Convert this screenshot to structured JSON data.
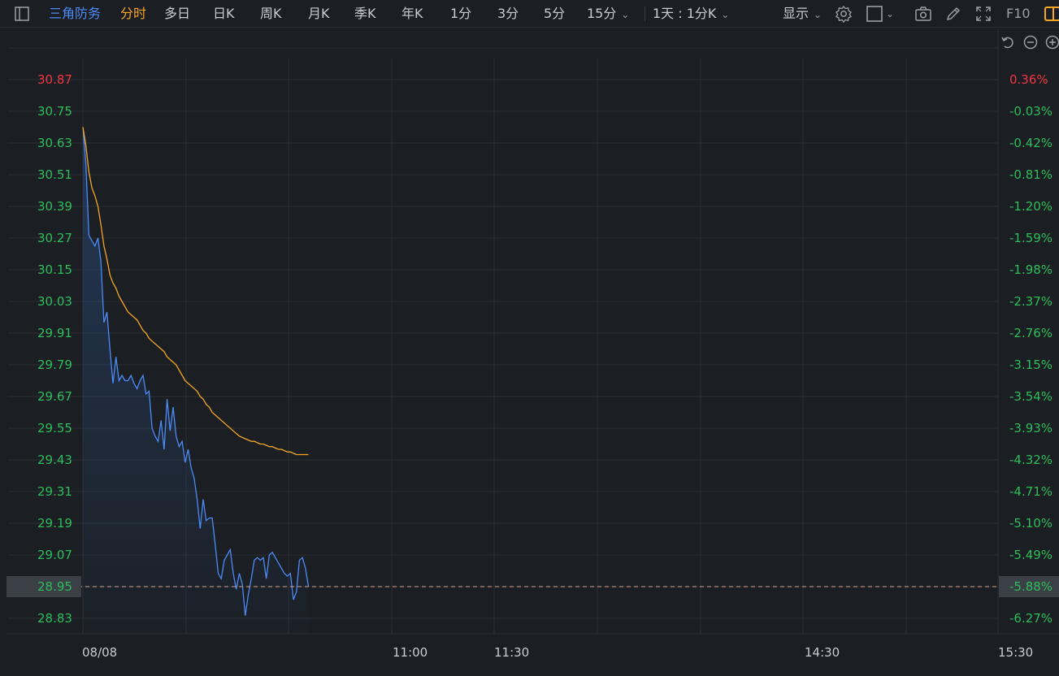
{
  "toolbar": {
    "stock_name": "三角防务",
    "tabs": [
      "分时",
      "多日",
      "日K",
      "周K",
      "月K",
      "季K",
      "年K",
      "1分",
      "3分",
      "5分",
      "15分"
    ],
    "active_tab": "分时",
    "period_select": "1天 : 1分K",
    "display_label": "显示",
    "f10_label": "F10"
  },
  "colors": {
    "background": "#1b1e22",
    "grid": "#2b3036",
    "price_line": "#4c8bf5",
    "avg_line": "#f6a623",
    "up": "#f23645",
    "down": "#2dbe5b",
    "current_marker": "#d9a48b"
  },
  "chart_data": {
    "type": "line",
    "x_ticks": [
      "08/08",
      "11:00",
      "11:30",
      "14:30",
      "15:30"
    ],
    "y_ticks_left": [
      "30.87",
      "30.75",
      "30.63",
      "30.51",
      "30.39",
      "30.27",
      "30.15",
      "30.03",
      "29.91",
      "29.79",
      "29.67",
      "29.55",
      "29.43",
      "29.31",
      "29.19",
      "29.07",
      "28.95",
      "28.83"
    ],
    "y_ticks_right": [
      "0.36%",
      "-0.03%",
      "-0.42%",
      "-0.81%",
      "-1.20%",
      "-1.59%",
      "-1.98%",
      "-2.37%",
      "-2.76%",
      "-3.15%",
      "-3.54%",
      "-3.93%",
      "-4.32%",
      "-4.71%",
      "-5.10%",
      "-5.49%",
      "-5.88%",
      "-6.27%"
    ],
    "ylim": [
      28.83,
      30.87
    ],
    "current_price": "28.95",
    "current_pct": "-5.88%",
    "series": [
      {
        "values": [
          30.69,
          30.55,
          30.28,
          30.26,
          30.24,
          30.27,
          30.18,
          29.95,
          29.99,
          29.85,
          29.72,
          29.82,
          29.73,
          29.75,
          29.73,
          29.73,
          29.75,
          29.72,
          29.7,
          29.73,
          29.75,
          29.68,
          29.69,
          29.55,
          29.52,
          29.5,
          29.58,
          29.47,
          29.66,
          29.54,
          29.63,
          29.52,
          29.48,
          29.5,
          29.42,
          29.47,
          29.4,
          29.36,
          29.28,
          29.17,
          29.28,
          29.2,
          29.21,
          29.21,
          29.11,
          29.0,
          28.98,
          29.05,
          29.07,
          29.09,
          29.0,
          28.94,
          29.0,
          28.96,
          28.84,
          28.92,
          28.98,
          29.05,
          29.06,
          29.05,
          29.06,
          28.98,
          29.07,
          29.08,
          29.06,
          29.04,
          29.02,
          29.0,
          28.99,
          29.0,
          28.9,
          28.93,
          29.05,
          29.06,
          29.02,
          28.95
        ]
      },
      {
        "values": [
          30.69,
          30.62,
          30.52,
          30.46,
          30.43,
          30.39,
          30.32,
          30.24,
          30.19,
          30.13,
          30.1,
          30.08,
          30.05,
          30.03,
          30.01,
          29.99,
          29.98,
          29.97,
          29.96,
          29.94,
          29.92,
          29.91,
          29.89,
          29.88,
          29.87,
          29.86,
          29.85,
          29.84,
          29.82,
          29.81,
          29.8,
          29.79,
          29.77,
          29.75,
          29.73,
          29.72,
          29.71,
          29.7,
          29.69,
          29.67,
          29.66,
          29.64,
          29.63,
          29.61,
          29.6,
          29.59,
          29.58,
          29.57,
          29.56,
          29.55,
          29.54,
          29.53,
          29.52,
          29.515,
          29.51,
          29.505,
          29.5,
          29.5,
          29.495,
          29.49,
          29.49,
          29.485,
          29.48,
          29.48,
          29.475,
          29.47,
          29.47,
          29.465,
          29.46,
          29.46,
          29.455,
          29.45,
          29.45,
          29.45,
          29.45,
          29.45
        ]
      }
    ]
  }
}
